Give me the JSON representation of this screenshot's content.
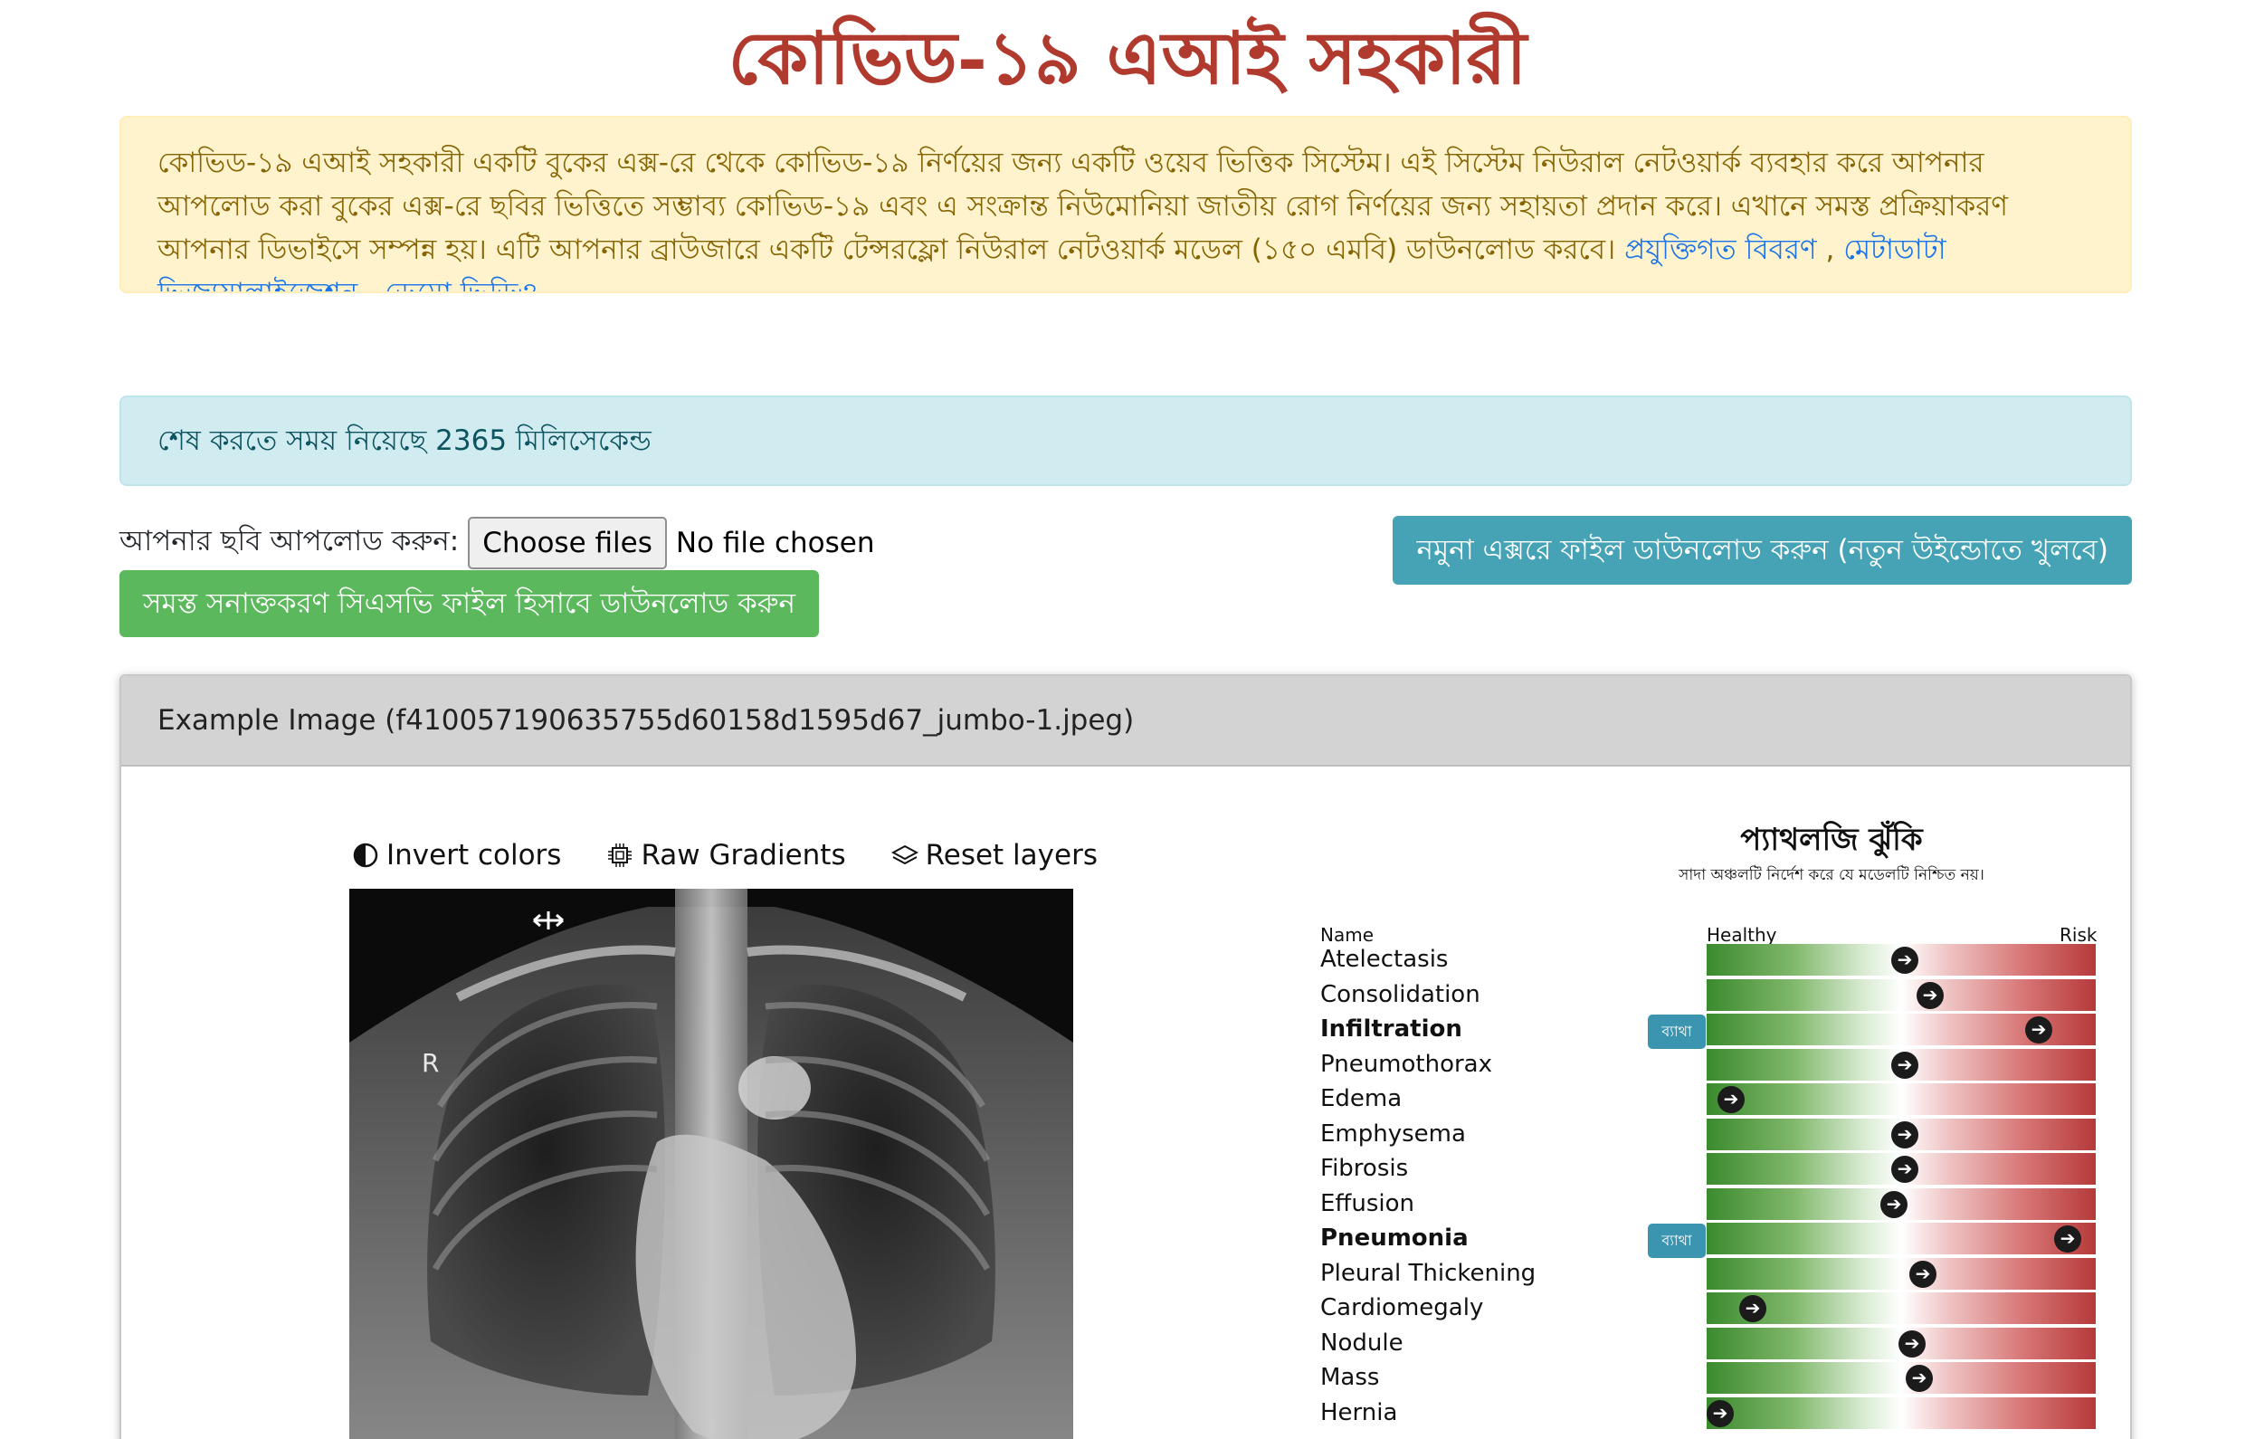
{
  "title": "কোভিড-১৯ এআই সহকারী",
  "intro": {
    "text": "কোভিড-১৯ এআই সহকারী একটি বুকের এক্স-রে থেকে কোভিড-১৯ নির্ণয়ের জন্য একটি ওয়েব ভিত্তিক সিস্টেম। এই সিস্টেম নিউরাল নেটওয়ার্ক ব্যবহার করে আপনার আপলোড করা বুকের এক্স-রে ছবির ভিত্তিতে সম্ভাব্য কোভিড-১৯ এবং এ সংক্রান্ত নিউমোনিয়া জাতীয় রোগ নির্ণয়ের জন্য সহায়তা প্রদান করে। এখানে সমস্ত প্রক্রিয়াকরণ আপনার ডিভাইসে সম্পন্ন হয়। এটি আপনার ব্রাউজারে একটি টেন্সরফ্লো নিউরাল নেটওয়ার্ক মডেল (১৫০ এমবি) ডাউনলোড করবে।",
    "link_technical": "প্রযুক্তিগত বিবরণ",
    "link_metadata": "মেটাডাটা ভিজ্যুয়ালাইজেশন",
    "link_demo": "ডেমো ভিডিও",
    "separator": ","
  },
  "status": "শেষ করতে সময় নিয়েছে 2365 মিলিসেকেন্ড",
  "upload": {
    "label": "আপনার ছবি আপলোড করুন:",
    "button": "Choose files",
    "file_status": "No file chosen"
  },
  "csv_button": "সমস্ত সনাক্তকরণ সিএসভি ফাইল হিসাবে ডাউনলোড করুন",
  "sample_button": "নমুনা এক্সরে ফাইল ডাউনলোড করুন (নতুন উইন্ডোতে খুলবে)",
  "card": {
    "header": "Example Image (f410057190635755d60158d1595d67_jumbo-1.jpeg)",
    "tools": {
      "invert": "Invert colors",
      "gradients": "Raw Gradients",
      "reset": "Reset layers"
    },
    "xray_marker": "R"
  },
  "pathology": {
    "title": "প্যাথলজি ঝুঁকি",
    "subtitle": "সাদা অঞ্চলটি নির্দেশ করে যে মডেলটি নিশ্চিত নয়।",
    "col_name": "Name",
    "col_healthy": "Healthy",
    "col_risk": "Risk",
    "badge_label": "ব্যাথা",
    "colors": {
      "healthy": "#3b8a2e",
      "risk": "#b53a3a",
      "badge": "#3b95b0"
    },
    "rows": [
      {
        "name": "Atelectasis",
        "risk": 0.51,
        "bold": false,
        "flagged": false
      },
      {
        "name": "Consolidation",
        "risk": 0.58,
        "bold": false,
        "flagged": false
      },
      {
        "name": "Infiltration",
        "risk": 0.88,
        "bold": true,
        "flagged": true
      },
      {
        "name": "Pneumothorax",
        "risk": 0.51,
        "bold": false,
        "flagged": false
      },
      {
        "name": "Edema",
        "risk": 0.03,
        "bold": false,
        "flagged": false
      },
      {
        "name": "Emphysema",
        "risk": 0.51,
        "bold": false,
        "flagged": false
      },
      {
        "name": "Fibrosis",
        "risk": 0.51,
        "bold": false,
        "flagged": false
      },
      {
        "name": "Effusion",
        "risk": 0.48,
        "bold": false,
        "flagged": false
      },
      {
        "name": "Pneumonia",
        "risk": 0.96,
        "bold": true,
        "flagged": true
      },
      {
        "name": "Pleural Thickening",
        "risk": 0.56,
        "bold": false,
        "flagged": false
      },
      {
        "name": "Cardiomegaly",
        "risk": 0.09,
        "bold": false,
        "flagged": false
      },
      {
        "name": "Nodule",
        "risk": 0.53,
        "bold": false,
        "flagged": false
      },
      {
        "name": "Mass",
        "risk": 0.55,
        "bold": false,
        "flagged": false
      },
      {
        "name": "Hernia",
        "risk": 0.0,
        "bold": false,
        "flagged": false
      }
    ]
  }
}
